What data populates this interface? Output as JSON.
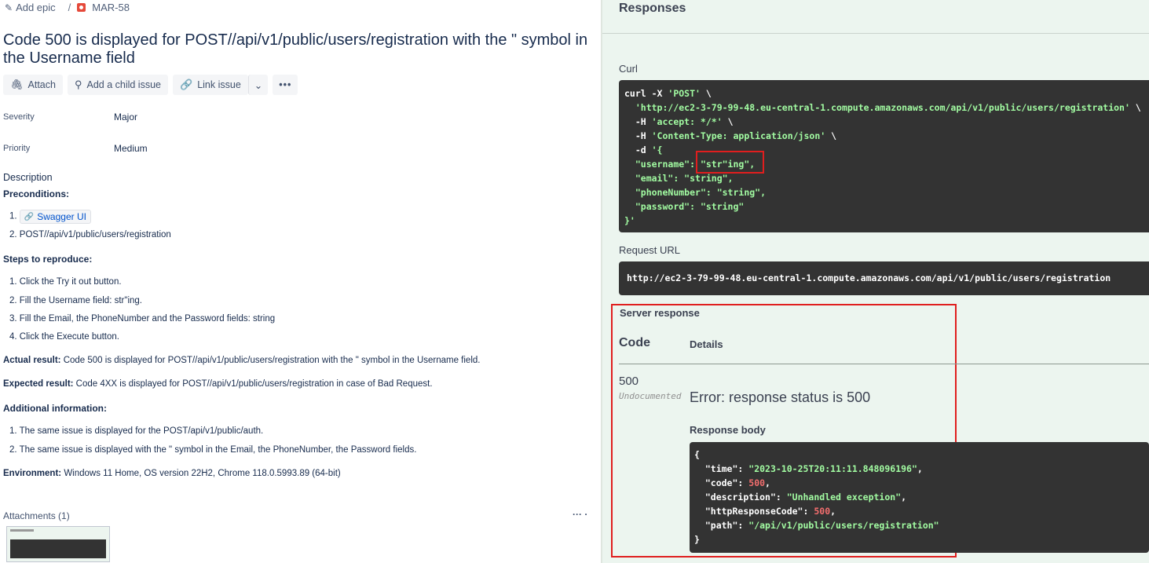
{
  "issue": {
    "breadcrumb": {
      "add_epic": "Add epic",
      "separator": "/",
      "key": "MAR-58"
    },
    "title": "Code 500 is displayed for POST//api/v1/public/users/registration with the \" symbol in the Username field",
    "actions": {
      "attach": "Attach",
      "add_child": "Add a child issue",
      "link": "Link issue",
      "more": "•••"
    },
    "fields": [
      {
        "label": "Severity",
        "value": "Major"
      },
      {
        "label": "Priority",
        "value": "Medium"
      }
    ],
    "description": {
      "heading": "Description",
      "preconditions_title": "Preconditions:",
      "preconditions": [
        {
          "num": "1.",
          "link_text": "Swagger UI"
        },
        {
          "num": "2.",
          "text": "POST//api/v1/public/users/registration"
        }
      ],
      "steps_title": "Steps to reproduce:",
      "steps": [
        "1. Click the Try it out button.",
        "2. Fill the Username field: str\"ing.",
        "3. Fill the Email, the PhoneNumber and the Password fields: string",
        "4. Click the Execute button."
      ],
      "actual_label": "Actual result:",
      "actual_text": " Code 500 is displayed for POST//api/v1/public/users/registration with the \" symbol in the Username field.",
      "expected_label": "Expected result:",
      "expected_text": " Code 4XX is displayed for POST//api/v1/public/users/registration in case of Bad Request.",
      "additional_title": "Additional information:",
      "additional": [
        "1. The same issue is displayed for the POST/api/v1/public/auth.",
        "2. The same issue is displayed with the \" symbol in the Email, the PhoneNumber, the Password fields."
      ],
      "environment_label": "Environment:",
      "environment_text": " Windows 11 Home, OS version 22H2, Chrome 118.0.5993.89 (64-bit)"
    },
    "attachments": {
      "title": "Attachments (1)",
      "menu": "··· ·"
    }
  },
  "swagger": {
    "responses_title": "Responses",
    "curl_label": "Curl",
    "curl_lines": [
      {
        "pre": "curl -X ",
        "str": "'POST'",
        "post": " \\"
      },
      {
        "pre": "  ",
        "str": "'http://ec2-3-79-99-48.eu-central-1.compute.amazonaws.com/api/v1/public/users/registration'",
        "post": " \\"
      },
      {
        "pre": "  -H ",
        "str": "'accept: */*'",
        "post": " \\"
      },
      {
        "pre": "  -H ",
        "str": "'Content-Type: application/json'",
        "post": " \\"
      },
      {
        "pre": "  -d ",
        "str": "'{",
        "post": ""
      },
      {
        "pre": "  ",
        "str": "\"username\": \"str\"ing\",",
        "post": ""
      },
      {
        "pre": "  ",
        "str": "\"email\": \"string\",",
        "post": ""
      },
      {
        "pre": "  ",
        "str": "\"phoneNumber\": \"string\",",
        "post": ""
      },
      {
        "pre": "  ",
        "str": "\"password\": \"string\"",
        "post": ""
      },
      {
        "pre": "",
        "str": "}'",
        "post": ""
      }
    ],
    "request_url_label": "Request URL",
    "request_url": "http://ec2-3-79-99-48.eu-central-1.compute.amazonaws.com/api/v1/public/users/registration",
    "server_response_label": "Server response",
    "code_header": "Code",
    "details_header": "Details",
    "status_code": "500",
    "undocumented": "Undocumented",
    "error_text": "Error: response status is 500",
    "response_body_label": "Response body",
    "body": {
      "open": "{",
      "time_key": "\"time\"",
      "time_val": "\"2023-10-25T20:11:11.848096196\"",
      "code_key": "\"code\"",
      "code_val": "500",
      "desc_key": "\"description\"",
      "desc_val": "\"Unhandled exception\"",
      "http_key": "\"httpResponseCode\"",
      "http_val": "500",
      "path_key": "\"path\"",
      "path_val": "\"/api/v1/public/users/registration\"",
      "close": "}"
    },
    "colors": {
      "highlight": "#e01e1e",
      "code_bg": "#333333",
      "string": "#a2fca2",
      "number": "#f36e6e",
      "panel_bg": "#ecf5ef"
    }
  }
}
